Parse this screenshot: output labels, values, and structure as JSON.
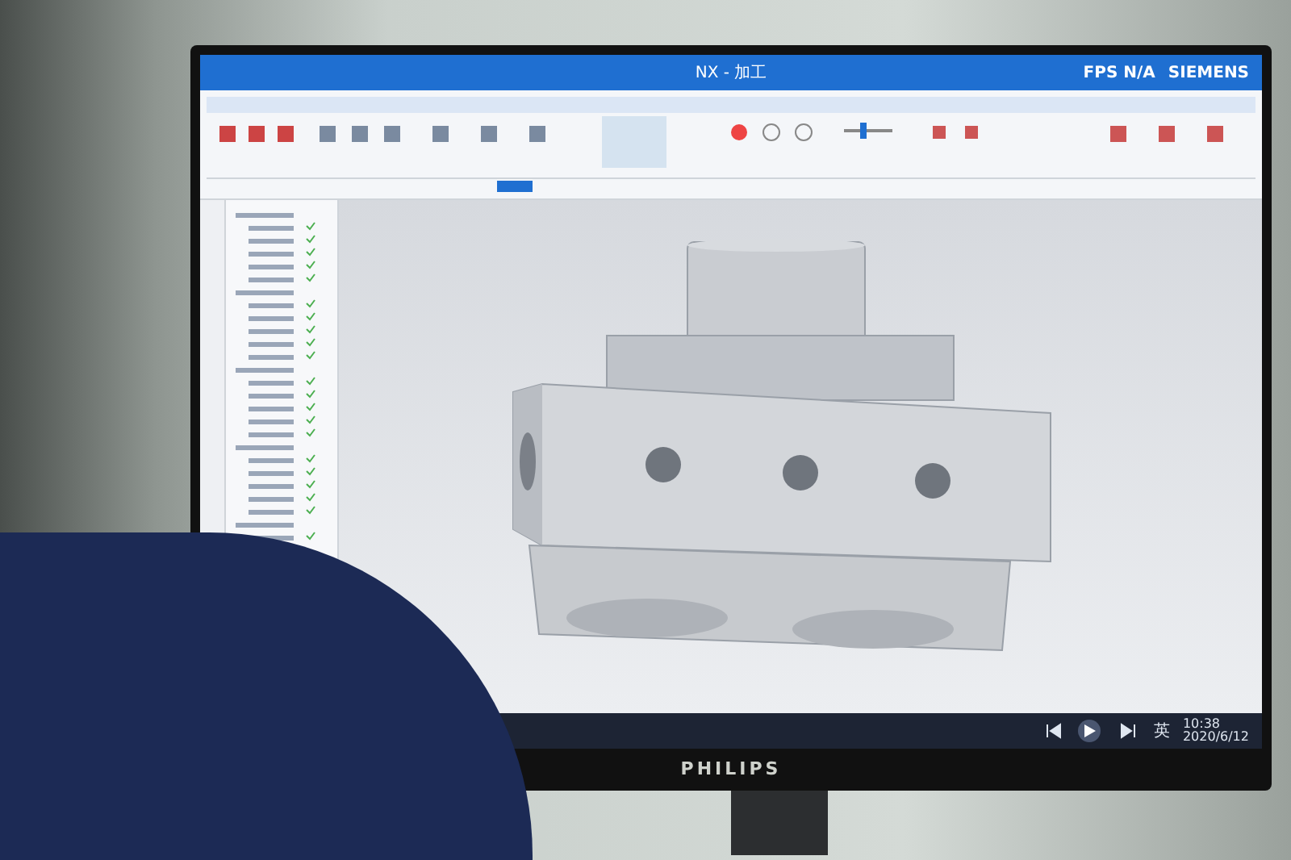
{
  "window": {
    "title": "NX - 加工",
    "fps": "FPS N/A",
    "brand": "SIEMENS"
  },
  "taskbar": {
    "ime": "英",
    "time": "10:38",
    "date": "2020/6/12"
  },
  "monitor": {
    "brand": "PHILIPS"
  }
}
